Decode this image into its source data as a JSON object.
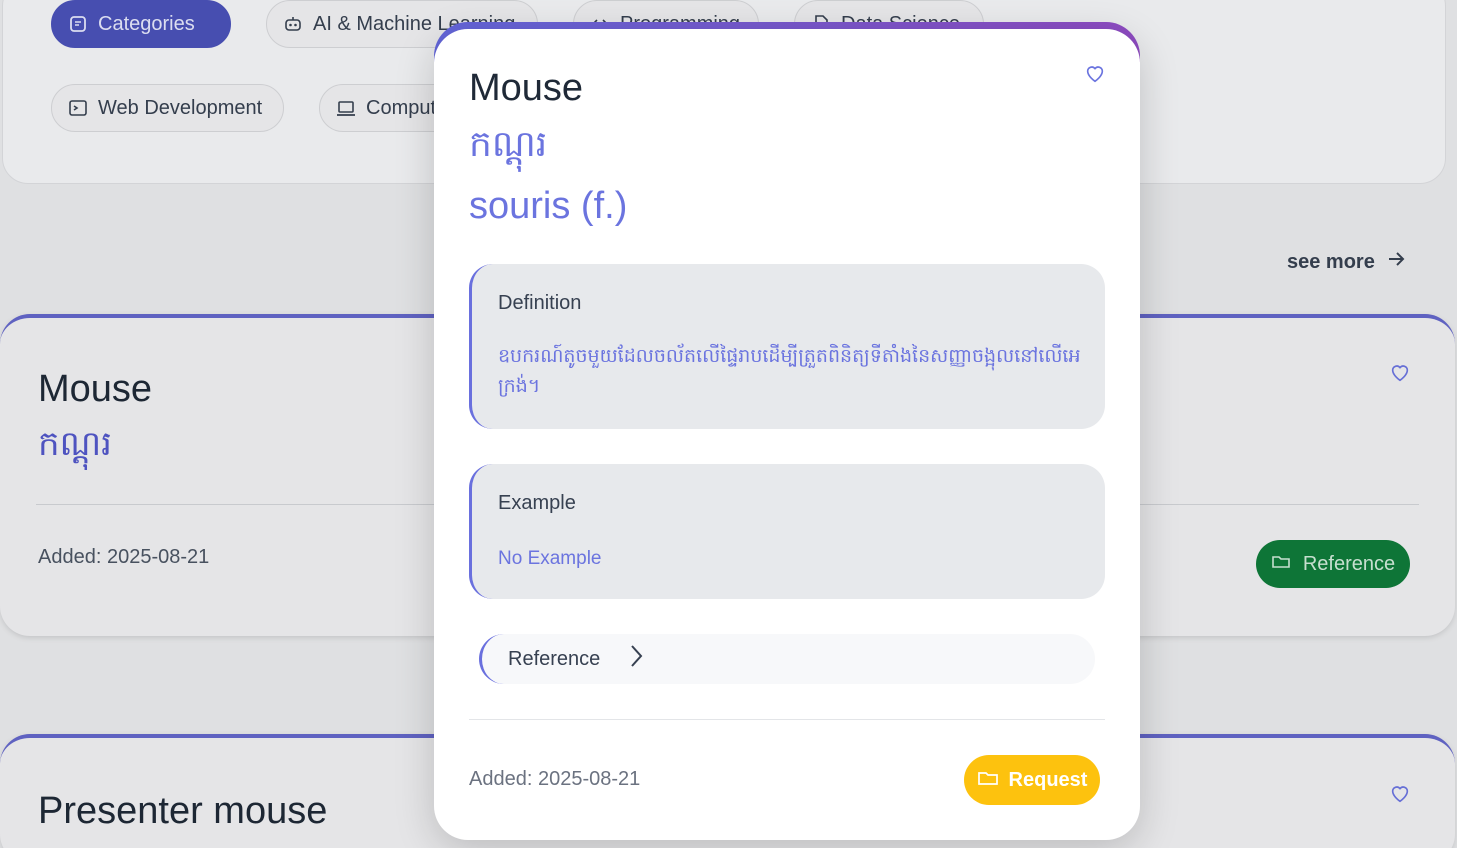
{
  "categories": {
    "chips": [
      {
        "label": "Categories",
        "icon": "categories-icon",
        "active": true
      },
      {
        "label": "AI & Machine Learning",
        "icon": "robot-icon"
      },
      {
        "label": "Programming",
        "icon": "code-icon"
      },
      {
        "label": "Data Science",
        "icon": "document-icon"
      },
      {
        "label": "Web Development",
        "icon": "terminal-icon"
      },
      {
        "label": "Computer",
        "icon": "laptop-icon"
      }
    ]
  },
  "see_more": "see more",
  "cards": [
    {
      "word": "Mouse",
      "khmer": "កណ្ដុរ",
      "added": "Added: 2025-08-21",
      "reference_label": "Reference"
    },
    {
      "word": "Presenter mouse"
    }
  ],
  "modal": {
    "title": "Mouse",
    "khmer": "កណ្ដុរ",
    "french": "souris (f.)",
    "definition_label": "Definition",
    "definition_text": "ឧបករណ៍តូចមួយដែលចល័តលើផ្ទៃរាបដើម្បីត្រួតពិនិត្យទីតាំងនៃសញ្ញាចង្អុលនៅលើអេក្រង់។",
    "example_label": "Example",
    "example_text": "No Example",
    "reference_label": "Reference",
    "added": "Added: 2025-08-21",
    "request_label": "Request"
  },
  "colors": {
    "accent": "#6b74df",
    "chip_active": "#4a52b8",
    "request": "#fdc20e",
    "reference_green": "#0f7a3a"
  }
}
